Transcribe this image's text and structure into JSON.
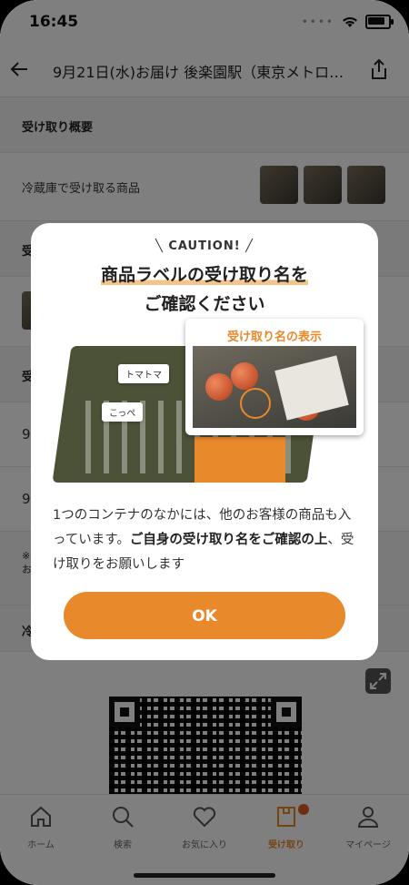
{
  "status": {
    "time": "16:45"
  },
  "nav": {
    "title": "9月21日(水)お届け 後楽園駅（東京メトロ…"
  },
  "bg": {
    "section_overview": "受け取り概要",
    "fridge_label": "冷蔵庫で受け取る商品",
    "section2_partial": "受",
    "section3_partial": "受",
    "row_9a": "9",
    "row_9b": "9",
    "note_partial": "※\nお",
    "cold_partial": "冷"
  },
  "modal": {
    "caution": "CAUTION!",
    "title_line1": "商品ラベルの受け取り名を",
    "title_line2": "ご確認ください",
    "inset_title": "受け取り名の表示",
    "tag1": "トマトマ",
    "tag2": "こっぺ",
    "body_part1": "1つのコンテナのなかには、他のお客様の商品も入っています。",
    "body_bold": "ご自身の受け取り名をご確認の上",
    "body_part2": "、受け取りをお願いします",
    "ok_label": "OK"
  },
  "tabs": [
    {
      "label": "ホーム",
      "icon": "home-icon"
    },
    {
      "label": "検索",
      "icon": "search-icon"
    },
    {
      "label": "お気に入り",
      "icon": "heart-icon"
    },
    {
      "label": "受け取り",
      "icon": "pickup-icon"
    },
    {
      "label": "マイページ",
      "icon": "person-icon"
    }
  ],
  "colors": {
    "accent": "#e8892b",
    "badge": "#e05a28"
  }
}
